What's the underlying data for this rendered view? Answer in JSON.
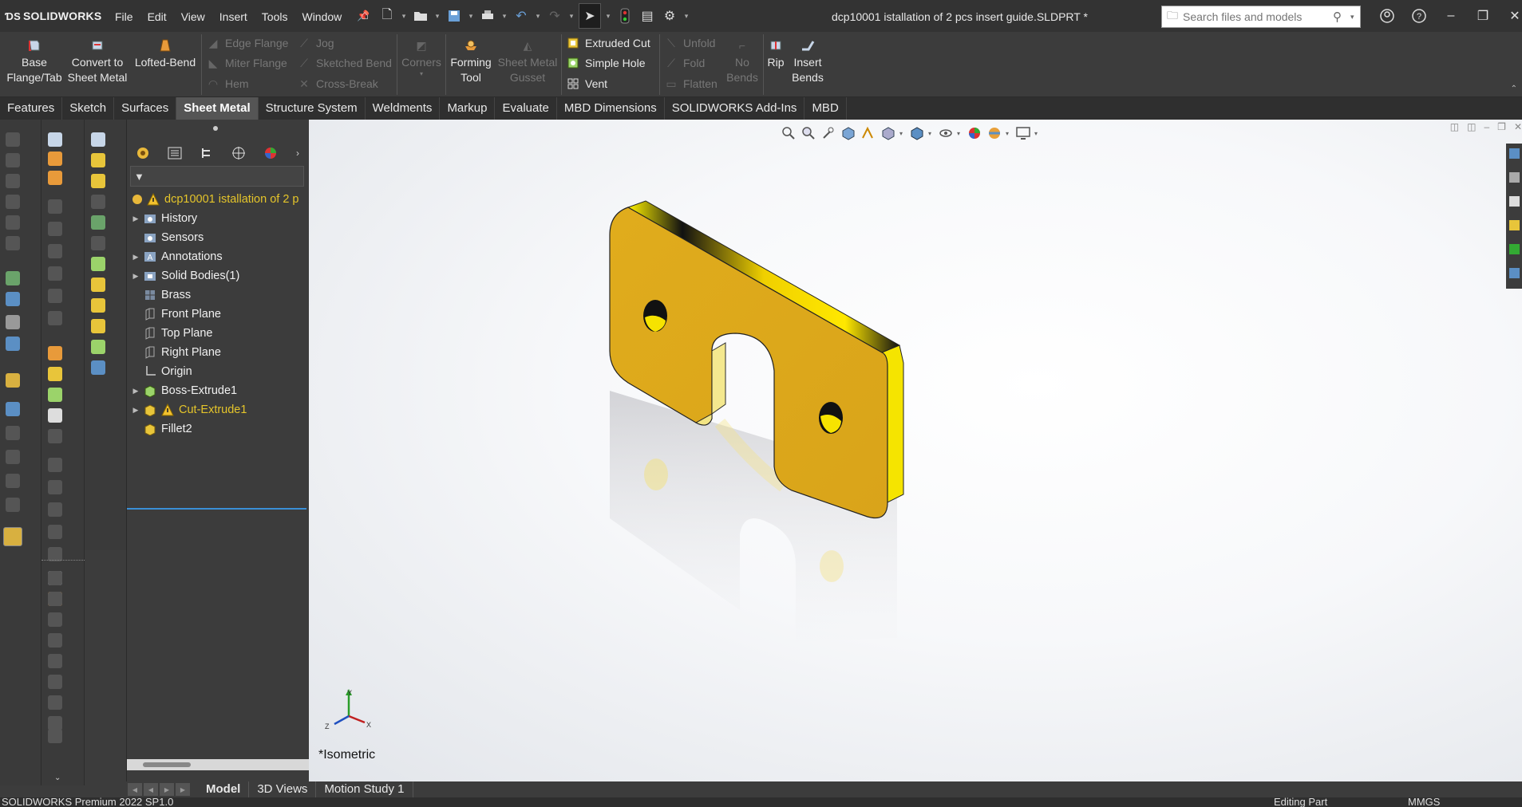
{
  "app": {
    "logo_text": "SOLIDWORKS",
    "document_title": "dcp10001 istallation of 2 pcs insert guide.SLDPRT *"
  },
  "menu": [
    "File",
    "Edit",
    "View",
    "Insert",
    "Tools",
    "Window"
  ],
  "search": {
    "placeholder": "Search files and models"
  },
  "ribbon": {
    "base_flange": "Base Flange/Tab",
    "convert": "Convert to Sheet Metal",
    "lofted_bend": "Lofted-Bend",
    "edge_flange": "Edge Flange",
    "miter_flange": "Miter Flange",
    "hem": "Hem",
    "jog": "Jog",
    "sketched_bend": "Sketched Bend",
    "cross_break": "Cross-Break",
    "corners": "Corners",
    "forming_tool": "Forming Tool",
    "gusset": "Sheet Metal Gusset",
    "extruded_cut": "Extruded Cut",
    "simple_hole": "Simple Hole",
    "vent": "Vent",
    "unfold": "Unfold",
    "fold": "Fold",
    "flatten": "Flatten",
    "no_bends": "No Bends",
    "rip": "Rip",
    "insert_bends": "Insert Bends"
  },
  "tabs": [
    "Features",
    "Sketch",
    "Surfaces",
    "Sheet Metal",
    "Structure System",
    "Weldments",
    "Markup",
    "Evaluate",
    "MBD Dimensions",
    "SOLIDWORKS Add-Ins",
    "MBD"
  ],
  "active_tab": "Sheet Metal",
  "tree": {
    "root": "dcp10001 istallation of 2 p",
    "items": [
      {
        "label": "History",
        "expand": true
      },
      {
        "label": "Sensors",
        "expand": false
      },
      {
        "label": "Annotations",
        "expand": true
      },
      {
        "label": "Solid Bodies(1)",
        "expand": true
      },
      {
        "label": "Brass",
        "expand": false
      },
      {
        "label": "Front Plane",
        "expand": false
      },
      {
        "label": "Top Plane",
        "expand": false
      },
      {
        "label": "Right Plane",
        "expand": false
      },
      {
        "label": "Origin",
        "expand": false
      },
      {
        "label": "Boss-Extrude1",
        "expand": true
      },
      {
        "label": "Cut-Extrude1",
        "expand": true,
        "warning": true
      },
      {
        "label": "Fillet2",
        "expand": false
      }
    ]
  },
  "viewport": {
    "view_label": "*Isometric",
    "triad": {
      "x": "X",
      "y": "Y",
      "z": "Z"
    },
    "part_color": "#e6b31e"
  },
  "bottom_tabs": [
    "Model",
    "3D Views",
    "Motion Study 1"
  ],
  "status": {
    "left": "SOLIDWORKS Premium 2022 SP1.0",
    "editing": "Editing Part",
    "units": "MMGS"
  }
}
